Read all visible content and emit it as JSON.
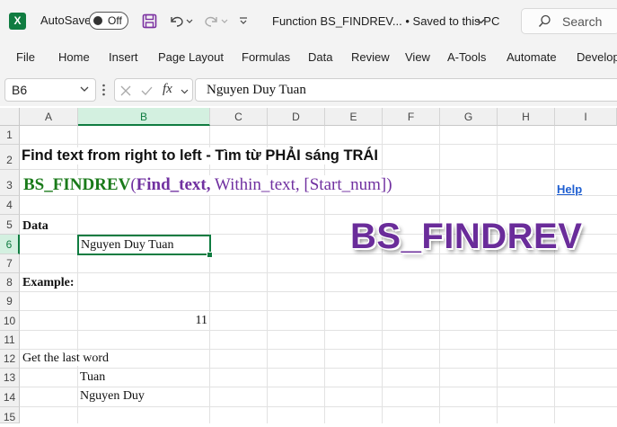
{
  "titlebar": {
    "autosave_label": "AutoSave",
    "toggle_state": "Off",
    "document_title": "Function BS_FINDREV...  •  Saved to this PC",
    "search_placeholder": "Search"
  },
  "ribbon": {
    "tabs": [
      "File",
      "Home",
      "Insert",
      "Page Layout",
      "Formulas",
      "Data",
      "Review",
      "View",
      "A-Tools",
      "Automate",
      "Develop"
    ]
  },
  "formula_bar": {
    "name_box": "B6",
    "fx_label": "fx",
    "formula": "Nguyen Duy Tuan"
  },
  "columns": [
    "A",
    "B",
    "C",
    "D",
    "E",
    "F",
    "G",
    "H",
    "I"
  ],
  "active_column": "B",
  "rows": [
    "1",
    "2",
    "3",
    "4",
    "5",
    "6",
    "7",
    "8",
    "9",
    "10",
    "11",
    "12",
    "13",
    "14",
    "15"
  ],
  "active_row": "6",
  "sheet": {
    "heading": "Find text from right to left - Tìm từ PHẢI sáng TRÁI",
    "syntax": {
      "name": "BS_FINDREV",
      "open_paren": "(",
      "arg1": "Find_text,",
      "arg2": " Within_text,",
      "arg3": " [Start_num]",
      "close_paren": ")"
    },
    "help": "Help",
    "data_label": "Data",
    "data_value": "Nguyen Duy Tuan",
    "example_label": "Example:",
    "result_value": "11",
    "last_word_label": "Get the last word",
    "last_word_result": "Tuan",
    "remainder_result": "Nguyen Duy",
    "banner": "BS_FINDREV"
  },
  "colors": {
    "excel_green": "#107c41",
    "function_green": "#1a7a1a",
    "argument_purple": "#7030a0",
    "banner_purple": "#6a2c9a",
    "link_blue": "#1f5fd1"
  }
}
